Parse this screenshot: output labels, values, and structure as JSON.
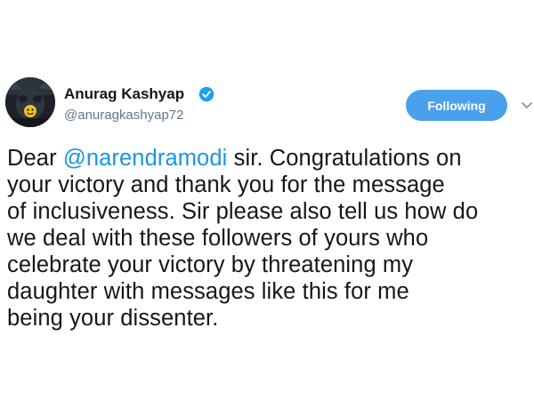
{
  "author": {
    "name": "Anurag Kashyap",
    "handle": "@anuragkashyap72",
    "avatar_icon": "avatar-image",
    "verified_icon": "verified-badge-icon"
  },
  "follow_button": {
    "label": "Following"
  },
  "menu_icon": "chevron-down-icon",
  "tweet": {
    "line1_prefix": "Dear ",
    "mention": "@narendramodi",
    "line1_suffix": " sir. Congratulations on",
    "line2": "your victory and thank you for the message",
    "line3": "of inclusiveness. Sir please also tell us how do",
    "line4": "we deal with these followers of yours who",
    "line5": "celebrate your victory by threatening my",
    "line6": "daughter with messages like this for me",
    "line7": "being your dissenter."
  },
  "colors": {
    "accent": "#1b95e0",
    "button": "#4aa1eb",
    "text": "#14171a",
    "secondary": "#657786"
  }
}
